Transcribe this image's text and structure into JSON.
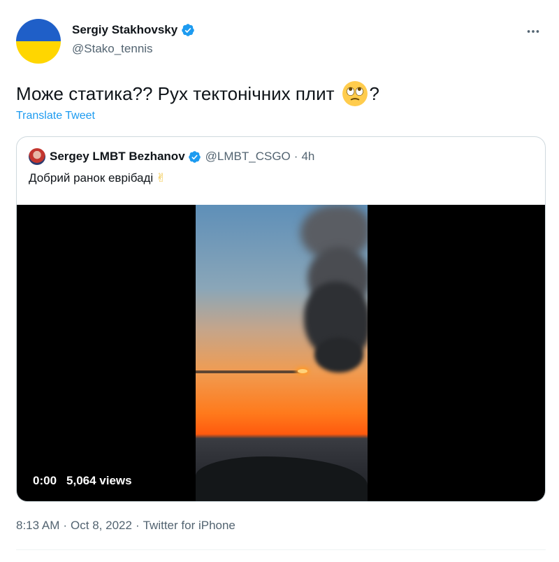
{
  "author": {
    "display_name": "Sergiy Stakhovsky",
    "handle": "@Stako_tennis",
    "verified_icon": "verified-badge-icon",
    "avatar_colors": [
      "#1f5fc8",
      "#ffd600"
    ]
  },
  "tweet": {
    "text_before": "Може статика?? Рух тектонічних плит",
    "emoji": "face-with-rolling-eyes-icon",
    "text_after": "?",
    "translate_label": "Translate Tweet"
  },
  "quote": {
    "display_name": "Sergey LMBT Bezhanov",
    "handle": "@LMBT_CSGO",
    "separator": "·",
    "time": "4h",
    "text": "Добрий ранок еврібаді",
    "emoji": "✌"
  },
  "video": {
    "timestamp": "0:00",
    "views": "5,064 views"
  },
  "footer": {
    "time": "8:13 AM",
    "separator": "·",
    "date": "Oct 8, 2022",
    "source": "Twitter for iPhone"
  },
  "colors": {
    "accent": "#1d9bf0",
    "secondary_text": "#536471",
    "border": "#cfd9de"
  }
}
